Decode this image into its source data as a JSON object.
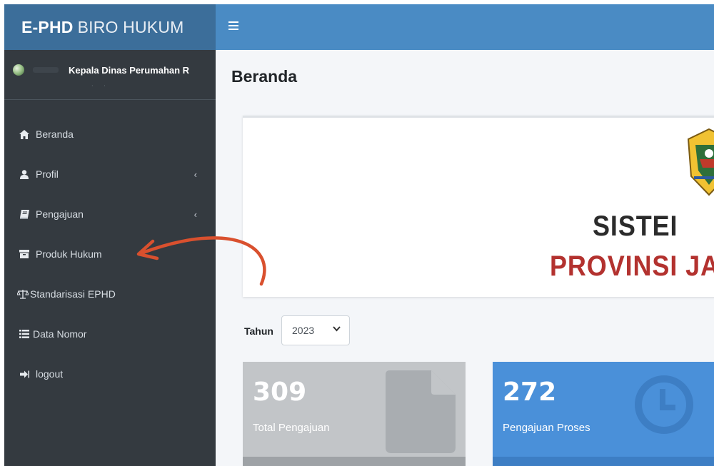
{
  "brand": {
    "bold": "E-PHD",
    "light": "BIRO HUKUM"
  },
  "header": {
    "menu_icon": "hamburger-icon"
  },
  "user": {
    "name": "Kepala Dinas Perumahan R",
    "avatar_icon": "avatar-icon"
  },
  "sidebar": {
    "items": [
      {
        "label": "Beranda",
        "icon": "home-icon"
      },
      {
        "label": "Profil",
        "icon": "user-icon",
        "chevron": "‹"
      },
      {
        "label": "Pengajuan",
        "icon": "book-icon",
        "chevron": "‹"
      },
      {
        "label": "Produk Hukum",
        "icon": "archive-icon"
      },
      {
        "label": "Standarisasi EPHD",
        "icon": "scale-icon"
      },
      {
        "label": "Data Nomor",
        "icon": "list-icon"
      },
      {
        "label": "logout",
        "icon": "logout-icon"
      }
    ]
  },
  "page": {
    "title": "Beranda"
  },
  "banner": {
    "line1": "SISTEI",
    "line2": "PROVINSI JA",
    "colors": {
      "line1": "#2b2b2b",
      "line2": "#b3322f"
    }
  },
  "filter": {
    "label": "Tahun",
    "selected": "2023"
  },
  "stats": [
    {
      "value": "309",
      "label": "Total Pengajuan",
      "color": "#c2c5c8",
      "icon": "document-icon"
    },
    {
      "value": "272",
      "label": "Pengajuan Proses",
      "color": "#4a90d9",
      "icon": "clock-icon"
    }
  ],
  "colors": {
    "brand": "#3c6e9a",
    "topbar": "#4a8bc4",
    "sidebar": "#343a40",
    "annotation_arrow": "#d9502e"
  }
}
